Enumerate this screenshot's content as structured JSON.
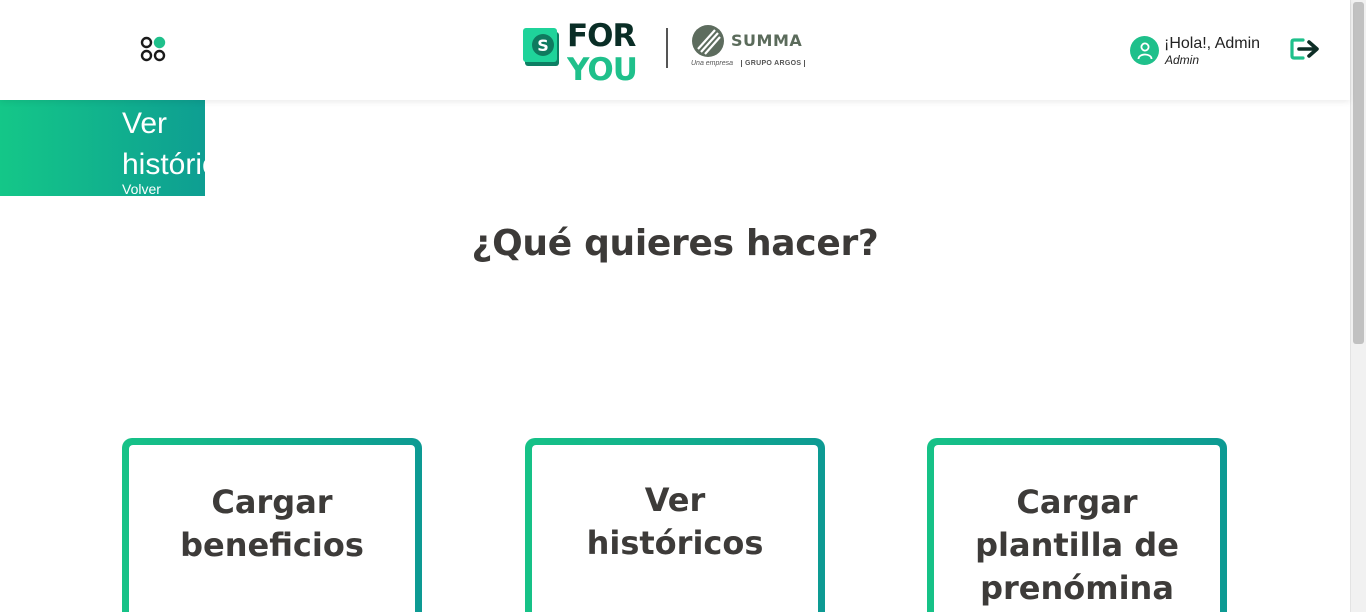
{
  "header": {
    "brand": {
      "mark_letter": "S",
      "name_top": "FOR",
      "name_bottom": "YOU",
      "partner": "SUMMA",
      "partner_sub_1": "Una empresa",
      "partner_sub_2": "GRUPO ARGOS"
    },
    "user": {
      "greeting": "¡Hola!, Admin",
      "role": "Admin"
    },
    "icons": {
      "apps": "apps-grid-icon",
      "avatar": "user-icon",
      "logout": "logout-icon"
    }
  },
  "banner": {
    "title": "Ver históricos",
    "back_label": "Volver"
  },
  "main": {
    "title": "¿Qué quieres hacer?",
    "options": [
      {
        "label": "Cargar beneficios"
      },
      {
        "label": "Ver históricos"
      },
      {
        "label": "Cargar plantilla de prenómina"
      }
    ]
  },
  "colors": {
    "accent_green": "#14c788",
    "accent_teal": "#0e9e92",
    "text_dark": "#3c3a38"
  }
}
